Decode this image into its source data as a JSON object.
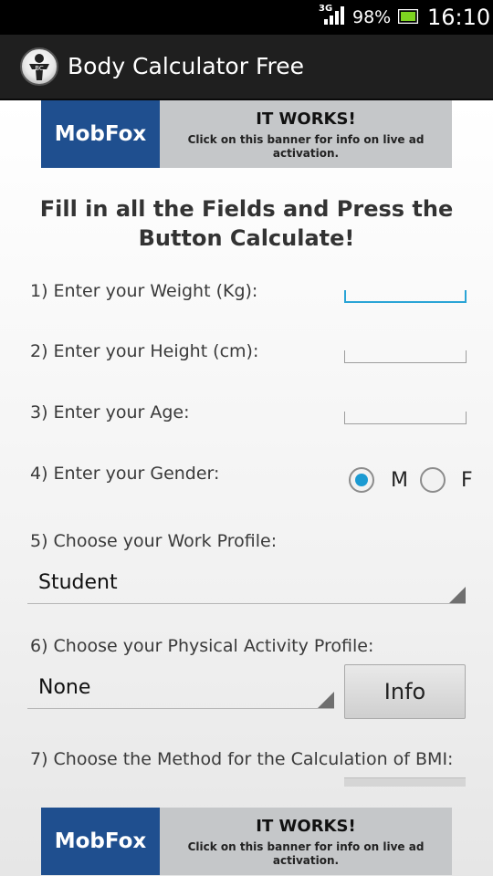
{
  "status_bar": {
    "network": "3G",
    "battery_percent": "98%",
    "time": "16:10"
  },
  "action_bar": {
    "app_title": "Body Calculator Free",
    "logo_text": "BC"
  },
  "ad_top": {
    "brand": "MobFox",
    "headline": "IT WORKS!",
    "subtext": "Click on this banner for info on live ad activation."
  },
  "instructions": "Fill in all the Fields and Press the Button Calculate!",
  "form": {
    "weight_label": "1) Enter your Weight (Kg):",
    "weight_value": "",
    "height_label": "2) Enter your Height (cm):",
    "height_value": "",
    "age_label": "3) Enter your Age:",
    "age_value": "",
    "gender_label": "4) Enter your Gender:",
    "gender_options": [
      "M",
      "F"
    ],
    "gender_selected": "M",
    "work_profile_label": "5) Choose your Work Profile:",
    "work_profile_value": "Student",
    "activity_label": "6) Choose your Physical Activity Profile:",
    "activity_value": "None",
    "info_button": "Info",
    "bmi_method_label": "7) Choose the Method for the Calculation of BMI:"
  },
  "ad_bottom": {
    "brand": "MobFox",
    "headline": "IT WORKS!",
    "subtext": "Click on this banner for info on live ad activation."
  },
  "colors": {
    "accent": "#1b9ad2",
    "focus": "#2aa4d6",
    "ad_brand_bg": "#1f4f8f"
  }
}
